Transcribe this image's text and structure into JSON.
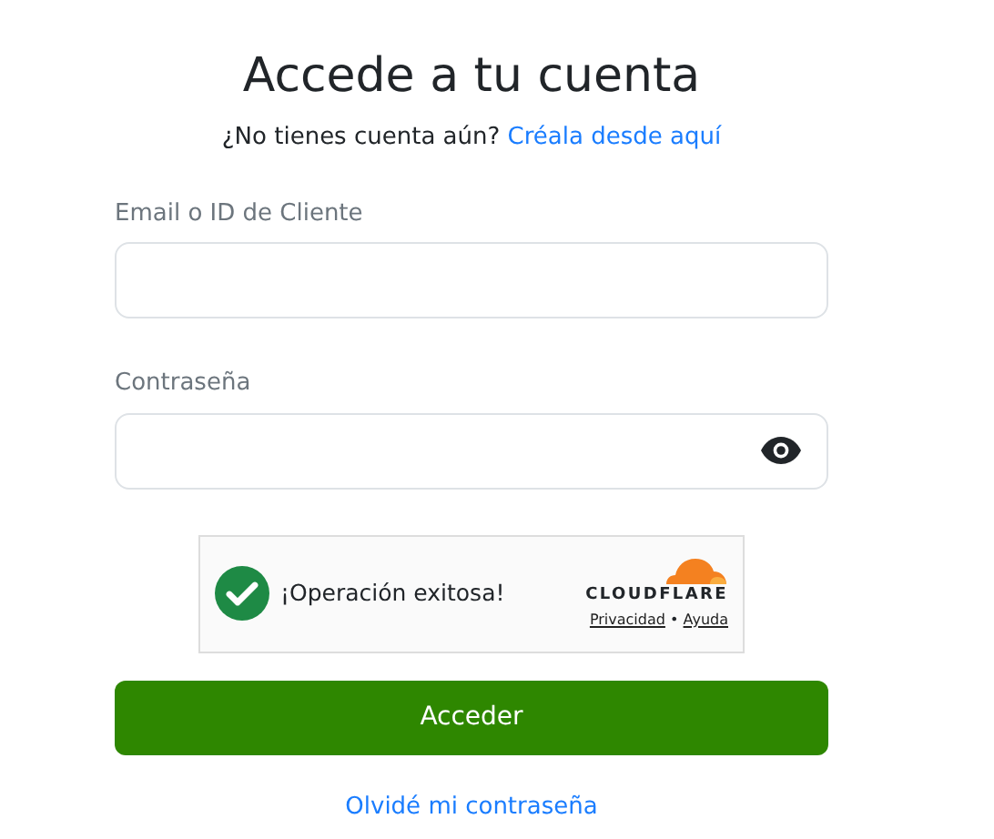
{
  "title": "Accede a tu cuenta",
  "signup": {
    "prompt": "¿No tienes cuenta aún?",
    "link": "Créala desde aquí"
  },
  "fields": [
    {
      "label": "Email o ID de Cliente",
      "kind": "text"
    },
    {
      "label": "Contraseña",
      "kind": "password"
    }
  ],
  "captcha": {
    "verified": true,
    "message": "¡Operación exitosa!",
    "brand": "CLOUDFLARE",
    "links": [
      "Privacidad",
      "Ayuda"
    ],
    "separator": "•"
  },
  "submit": "Acceder",
  "forgot": "Olvidé mi contraseña"
}
